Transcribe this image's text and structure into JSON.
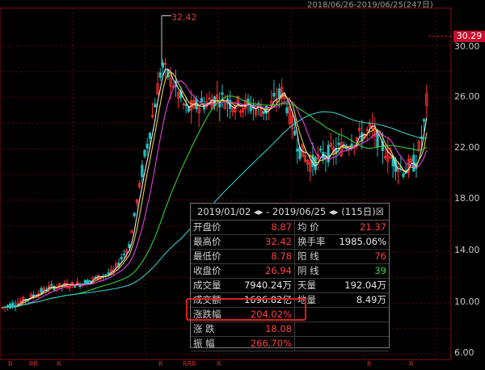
{
  "header": {
    "range": "2018/06/26-2019/06/25(247日)"
  },
  "axis": {
    "ticks": [
      "30.00",
      "26.00",
      "22.00",
      "18.00",
      "14.00",
      "10.00",
      "6.00"
    ]
  },
  "last_price": "30.29",
  "high_label": "32.42",
  "colors": {
    "up": "#ff3030",
    "down": "#20c0c0",
    "ma5": "#e8e8e8",
    "ma10": "#e8d040",
    "ma20": "#e040e0",
    "ma60": "#30d030",
    "ma120": "#30c8c8"
  },
  "r_marks": [
    "R",
    "RR",
    "R",
    "R",
    "RRR",
    "R",
    "R",
    "R"
  ],
  "stats": {
    "title": "2019/01/02 ◂▸ - 2019/06/25 ◂▸",
    "days": "(115日)☒",
    "rows": [
      {
        "l1": "开盘价",
        "v1": "8.87",
        "c1": "red",
        "l2": "均  价",
        "v2": "21.37",
        "c2": "red"
      },
      {
        "l1": "最高价",
        "v1": "32.42",
        "c1": "red",
        "l2": "换手率",
        "v2": "1985.06%",
        "c2": "white"
      },
      {
        "l1": "最低价",
        "v1": "8.78",
        "c1": "red",
        "l2": "阳  线",
        "v2": "76",
        "c2": "red"
      },
      {
        "l1": "收盘价",
        "v1": "26.94",
        "c1": "red",
        "l2": "阴  线",
        "v2": "39",
        "c2": "green"
      },
      {
        "l1": "成交量",
        "v1": "7940.24万",
        "c1": "white",
        "l2": "天量",
        "v2": "192.04万",
        "c2": "white"
      },
      {
        "l1": "成交额",
        "v1": "1696.82亿",
        "c1": "white",
        "l2": "地量",
        "v2": "8.49万",
        "c2": "white"
      },
      {
        "l1": "涨跌幅",
        "v1": "204.02%",
        "c1": "red",
        "l2": "",
        "v2": "",
        "c2": "white"
      },
      {
        "l1": "涨  跌",
        "v1": "18.08",
        "c1": "red",
        "l2": "",
        "v2": "",
        "c2": "white"
      },
      {
        "l1": "振  幅",
        "v1": "266.70%",
        "c1": "red",
        "l2": "",
        "v2": "",
        "c2": "white"
      }
    ]
  }
}
